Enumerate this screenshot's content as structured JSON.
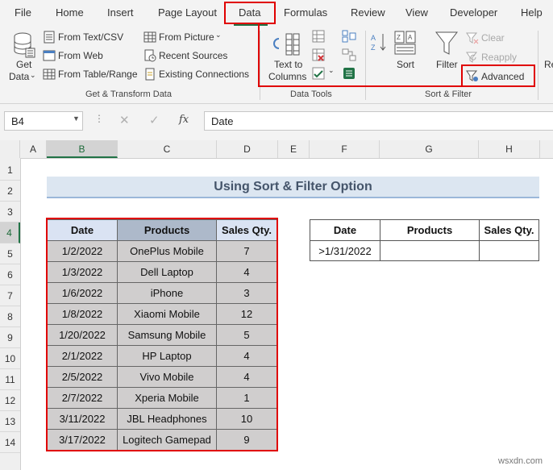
{
  "menu_tabs": [
    "File",
    "Home",
    "Insert",
    "Page Layout",
    "Data",
    "Formulas",
    "Review",
    "View",
    "Developer",
    "Help"
  ],
  "active_tab": "Data",
  "ribbon": {
    "get_data": [
      "Get",
      "Data"
    ],
    "get_transform": {
      "items": [
        "From Text/CSV",
        "From Web",
        "From Table/Range",
        "From Picture",
        "Recent Sources",
        "Existing Connections"
      ],
      "label": "Get & Transform Data"
    },
    "data_tools": {
      "text_to_columns": [
        "Text to",
        "Columns"
      ],
      "label": "Data Tools"
    },
    "sort_filter": {
      "sort": "Sort",
      "filter": "Filter",
      "clear": "Clear",
      "reapply": "Reapply",
      "advanced": "Advanced",
      "label": "Sort & Filter"
    },
    "partial": "Re"
  },
  "formula_bar": {
    "name_box": "B4",
    "content": "Date",
    "fx": "fx"
  },
  "columns": [
    "A",
    "B",
    "C",
    "D",
    "E",
    "F",
    "G",
    "H"
  ],
  "rows": [
    "1",
    "2",
    "3",
    "4",
    "5",
    "6",
    "7",
    "8",
    "9",
    "10",
    "11",
    "12",
    "13",
    "14"
  ],
  "sheet": {
    "title": "Using Sort & Filter Option",
    "headers": [
      "Date",
      "Products",
      "Sales Qty."
    ],
    "rows": [
      [
        "1/2/2022",
        "OnePlus Mobile",
        "7"
      ],
      [
        "1/3/2022",
        "Dell Laptop",
        "4"
      ],
      [
        "1/6/2022",
        "iPhone",
        "3"
      ],
      [
        "1/8/2022",
        "Xiaomi Mobile",
        "12"
      ],
      [
        "1/20/2022",
        "Samsung Mobile",
        "5"
      ],
      [
        "2/1/2022",
        "HP Laptop",
        "4"
      ],
      [
        "2/5/2022",
        "Vivo Mobile",
        "4"
      ],
      [
        "2/7/2022",
        "Xperia Mobile",
        "1"
      ],
      [
        "3/11/2022",
        "JBL Headphones",
        "10"
      ],
      [
        "3/17/2022",
        "Logitech Gamepad",
        "9"
      ]
    ],
    "criteria_headers": [
      "Date",
      "Products",
      "Sales Qty."
    ],
    "criteria_values": [
      ">1/31/2022",
      "",
      ""
    ]
  },
  "watermark": "wsxdn.com",
  "colors": {
    "highlight": "#e00000",
    "title_fill": "#dce6f1",
    "header_fill": "#d9e1f2",
    "data_fill": "#d0cece"
  }
}
